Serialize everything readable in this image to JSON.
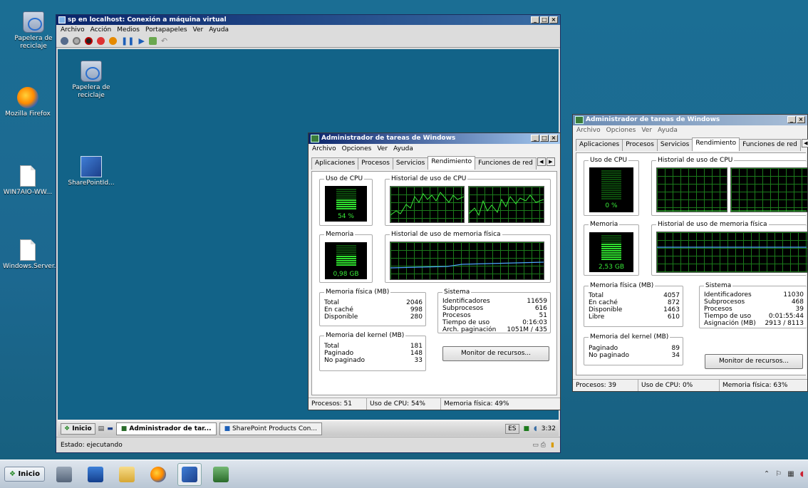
{
  "host_desktop": {
    "icons": [
      {
        "label": "Papelera de reciclaje",
        "icon": "recycle-bin-icon"
      },
      {
        "label": "Mozilla Firefox",
        "icon": "firefox-icon"
      },
      {
        "label": "WIN7AIO-WW...",
        "icon": "document-icon"
      },
      {
        "label": "Windows.Server...",
        "icon": "document-icon"
      }
    ]
  },
  "vm_window": {
    "title": "sp en localhost: Conexión a máquina virtual",
    "menu": [
      "Archivo",
      "Acción",
      "Medios",
      "Portapapeles",
      "Ver",
      "Ayuda"
    ],
    "status": "Estado: ejecutando",
    "guest_icons": [
      {
        "label": "Papelera de reciclaje",
        "icon": "recycle-bin-icon"
      },
      {
        "label": "SharePointId...",
        "icon": "sharepoint-setup-icon"
      }
    ],
    "guest_taskbar": {
      "start": "Inicio",
      "tasks": [
        "Administrador de tar...",
        "SharePoint Products Con..."
      ],
      "lang": "ES",
      "clock": "3:32"
    }
  },
  "task_manager_inner": {
    "title": "Administrador de tareas de Windows",
    "menu": [
      "Archivo",
      "Opciones",
      "Ver",
      "Ayuda"
    ],
    "tabs": [
      "Aplicaciones",
      "Procesos",
      "Servicios",
      "Rendimiento",
      "Funciones de red"
    ],
    "selected_tab": "Rendimiento",
    "cpu_label": "Uso de CPU",
    "cpu_value": "54 %",
    "cpu_level": 0.54,
    "cpu_history_label": "Historial de uso de CPU",
    "mem_label": "Memoria",
    "mem_value": "0,98 GB",
    "mem_level": 0.49,
    "mem_history_label": "Historial de uso de memoria física",
    "physical_memory": {
      "label": "Memoria física (MB)",
      "rows": [
        {
          "k": "Total",
          "v": "2046"
        },
        {
          "k": "En caché",
          "v": "998"
        },
        {
          "k": "Disponible",
          "v": "280"
        }
      ]
    },
    "kernel_memory": {
      "label": "Memoria del kernel (MB)",
      "rows": [
        {
          "k": "Total",
          "v": "181"
        },
        {
          "k": "Paginado",
          "v": "148"
        },
        {
          "k": "No paginado",
          "v": "33"
        }
      ]
    },
    "system": {
      "label": "Sistema",
      "rows": [
        {
          "k": "Identificadores",
          "v": "11659"
        },
        {
          "k": "Subprocesos",
          "v": "616"
        },
        {
          "k": "Procesos",
          "v": "51"
        },
        {
          "k": "Tiempo de uso",
          "v": "0:16:03"
        },
        {
          "k": "Arch. paginación",
          "v": "1051M / 435"
        }
      ]
    },
    "resource_monitor_button": "Monitor de recursos...",
    "status": {
      "processes": "Procesos: 51",
      "cpu": "Uso de CPU: 54%",
      "memory": "Memoria física: 49%"
    }
  },
  "task_manager_outer": {
    "title": "Administrador de tareas de Windows",
    "menu": [
      "Archivo",
      "Opciones",
      "Ver",
      "Ayuda"
    ],
    "tabs": [
      "Aplicaciones",
      "Procesos",
      "Servicios",
      "Rendimiento",
      "Funciones de red"
    ],
    "selected_tab": "Rendimiento",
    "cpu_label": "Uso de CPU",
    "cpu_value": "0 %",
    "cpu_level": 0.0,
    "cpu_history_label": "Historial de uso de CPU",
    "mem_label": "Memoria",
    "mem_value": "2,53 GB",
    "mem_level": 0.63,
    "mem_history_label": "Historial de uso de memoria física",
    "physical_memory": {
      "label": "Memoria física (MB)",
      "rows": [
        {
          "k": "Total",
          "v": "4057"
        },
        {
          "k": "En caché",
          "v": "872"
        },
        {
          "k": "Disponible",
          "v": "1463"
        },
        {
          "k": "Libre",
          "v": "610"
        }
      ]
    },
    "kernel_memory": {
      "label": "Memoria del kernel (MB)",
      "rows": [
        {
          "k": "Paginado",
          "v": "89"
        },
        {
          "k": "No paginado",
          "v": "34"
        }
      ]
    },
    "system": {
      "label": "Sistema",
      "rows": [
        {
          "k": "Identificadores",
          "v": "11030"
        },
        {
          "k": "Subprocesos",
          "v": "468"
        },
        {
          "k": "Procesos",
          "v": "39"
        },
        {
          "k": "Tiempo de uso",
          "v": "0:01:55:44"
        },
        {
          "k": "Asignación (MB)",
          "v": "2913 / 8113"
        }
      ]
    },
    "resource_monitor_button": "Monitor de recursos...",
    "status": {
      "processes": "Procesos: 39",
      "cpu": "Uso de CPU: 0%",
      "memory": "Memoria física: 63%"
    }
  },
  "host_taskbar": {
    "start": "Inicio",
    "apps": [
      "server-manager-icon",
      "powershell-icon",
      "explorer-folder-icon",
      "firefox-icon",
      "vm-connection-icon",
      "task-manager-icon"
    ]
  }
}
